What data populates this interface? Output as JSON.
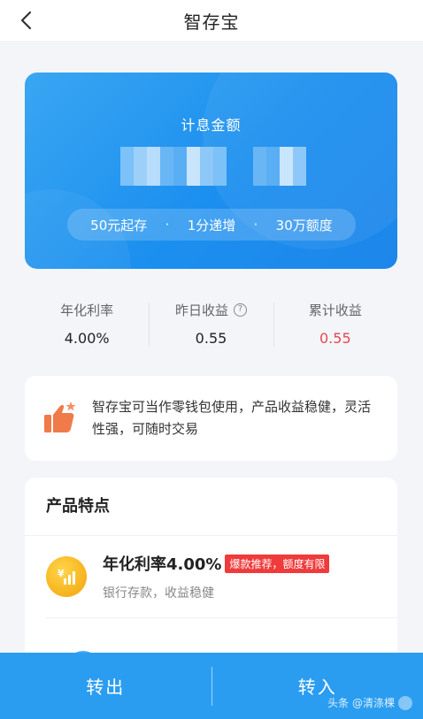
{
  "nav": {
    "title": "智存宝"
  },
  "hero": {
    "label": "计息金额",
    "tags": [
      "50元起存",
      "1分递增",
      "30万额度"
    ],
    "separator": "·"
  },
  "stats": [
    {
      "label": "年化利率",
      "value": "4.00%"
    },
    {
      "label": "昨日收益",
      "value": "0.55",
      "help": "?"
    },
    {
      "label": "累计收益",
      "value": "0.55"
    }
  ],
  "intro": {
    "text": "智存宝可当作零钱包使用，产品收益稳健，灵活性强，可随时交易"
  },
  "features": {
    "title": "产品特点",
    "items": [
      {
        "title": "年化利率4.00%",
        "tag": "爆款推荐，额度有限",
        "subtitle": "银行存款，收益稳健"
      }
    ]
  },
  "actions": {
    "withdraw": "转出",
    "deposit": "转入"
  },
  "watermark": {
    "text": "头条 @清涤棵"
  },
  "colors": {
    "primary": "#2a9df1",
    "accent_red": "#e5484d",
    "coin": "#f6b21c"
  }
}
